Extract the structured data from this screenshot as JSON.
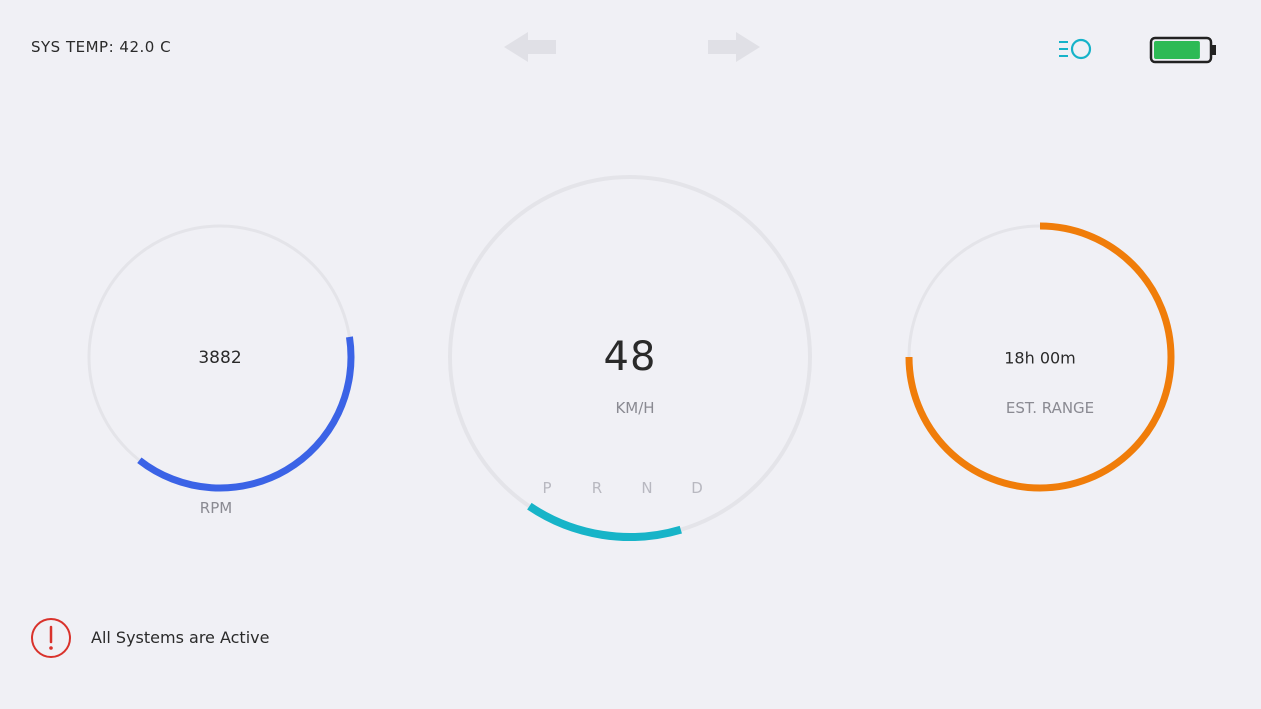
{
  "header": {
    "sys_temp": "SYS TEMP: 42.0 C",
    "left_turn_signal": "arrow-left-icon",
    "right_turn_signal": "arrow-right-icon",
    "headlight_icon": "headlight-icon",
    "battery_icon": "battery-icon",
    "battery_level": 0.85,
    "battery_color": "#2dba55",
    "headlight_color": "#16b3c9"
  },
  "rpm_gauge": {
    "value": "3882",
    "label": "RPM",
    "color": "#3b63e6",
    "fill": 0.38
  },
  "speed_gauge": {
    "value": "48",
    "unit": "KM/H",
    "color": "#17b4c8",
    "fill": 0.14,
    "gears": [
      "P",
      "R",
      "N",
      "D"
    ]
  },
  "range_gauge": {
    "value": "18h 00m",
    "label": "EST. RANGE",
    "color": "#f07d0a",
    "fill": 0.75
  },
  "status": {
    "icon": "alert-icon",
    "text": "All Systems are Active",
    "color": "#d9322b"
  }
}
